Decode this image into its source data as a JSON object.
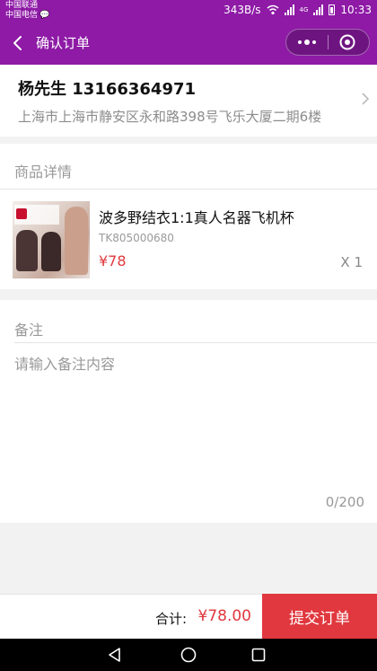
{
  "status_bar": {
    "carrier_1": "中国联通",
    "carrier_2": "中国电信",
    "network_speed": "343B/s",
    "signal_label": "4G",
    "time": "10:33"
  },
  "nav": {
    "title": "确认订单",
    "back_icon": "chevron-left-icon",
    "more_icon": "more-dots-icon",
    "close_icon": "target-circle-icon"
  },
  "address": {
    "name_phone": "杨先生  13166364971",
    "detail": "上海市上海市静安区永和路398号飞乐大厦二期6楼"
  },
  "goods": {
    "section_title": "商品详情",
    "items": [
      {
        "name": "波多野结衣1:1真人名器飞机杯",
        "code": "TK805000680",
        "price": "¥78",
        "quantity": "X 1"
      }
    ]
  },
  "remark": {
    "section_title": "备注",
    "placeholder": "请输入备注内容",
    "value": "",
    "counter": "0/200"
  },
  "footer": {
    "total_label": "合计:",
    "total_value": "¥78.00",
    "submit_label": "提交订单"
  },
  "colors": {
    "brand": "#8e1aa6",
    "accent": "#e0383e"
  }
}
